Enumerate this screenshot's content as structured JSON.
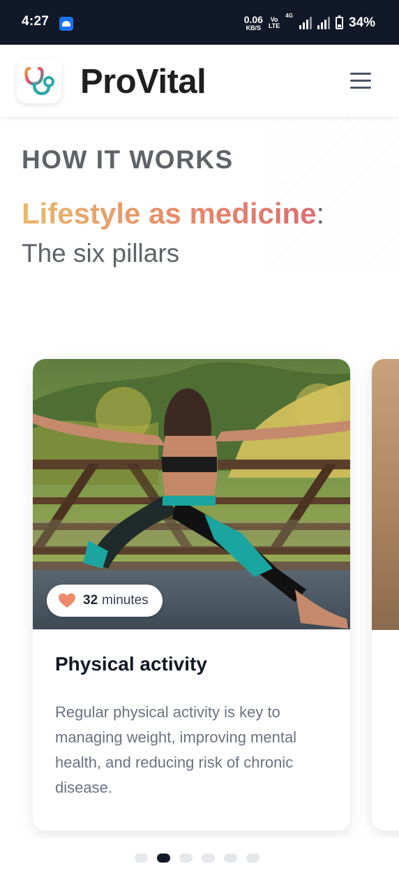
{
  "status_bar": {
    "time": "4:27",
    "net_speed_value": "0.06",
    "net_speed_unit": "KB/S",
    "volte_top": "Vo",
    "volte_bottom": "LTE",
    "signal_label": "4G",
    "battery": "34%"
  },
  "header": {
    "brand": "ProVital",
    "logo_icon": "stethoscope-icon",
    "menu_icon": "hamburger-menu-icon"
  },
  "section": {
    "eyebrow": "HOW IT WORKS",
    "headline_highlight": "Lifestyle as medicine",
    "headline_suffix": ":",
    "subheadline": "The six pillars"
  },
  "cards": [
    {
      "duration_value": "32",
      "duration_unit": "minutes",
      "duration_icon": "heart-icon",
      "title": "Physical activity",
      "description": "Regular physical activity is key to managing weight, improving mental health, and reducing risk of chronic disease."
    }
  ],
  "pagination": {
    "total": 6,
    "active_index": 1
  },
  "colors": {
    "status_bar_bg": "#111827",
    "gradient_start": "#e9b86c",
    "gradient_end": "#dd6e72",
    "active_dot": "#111827",
    "heart": "#f08a6a"
  }
}
